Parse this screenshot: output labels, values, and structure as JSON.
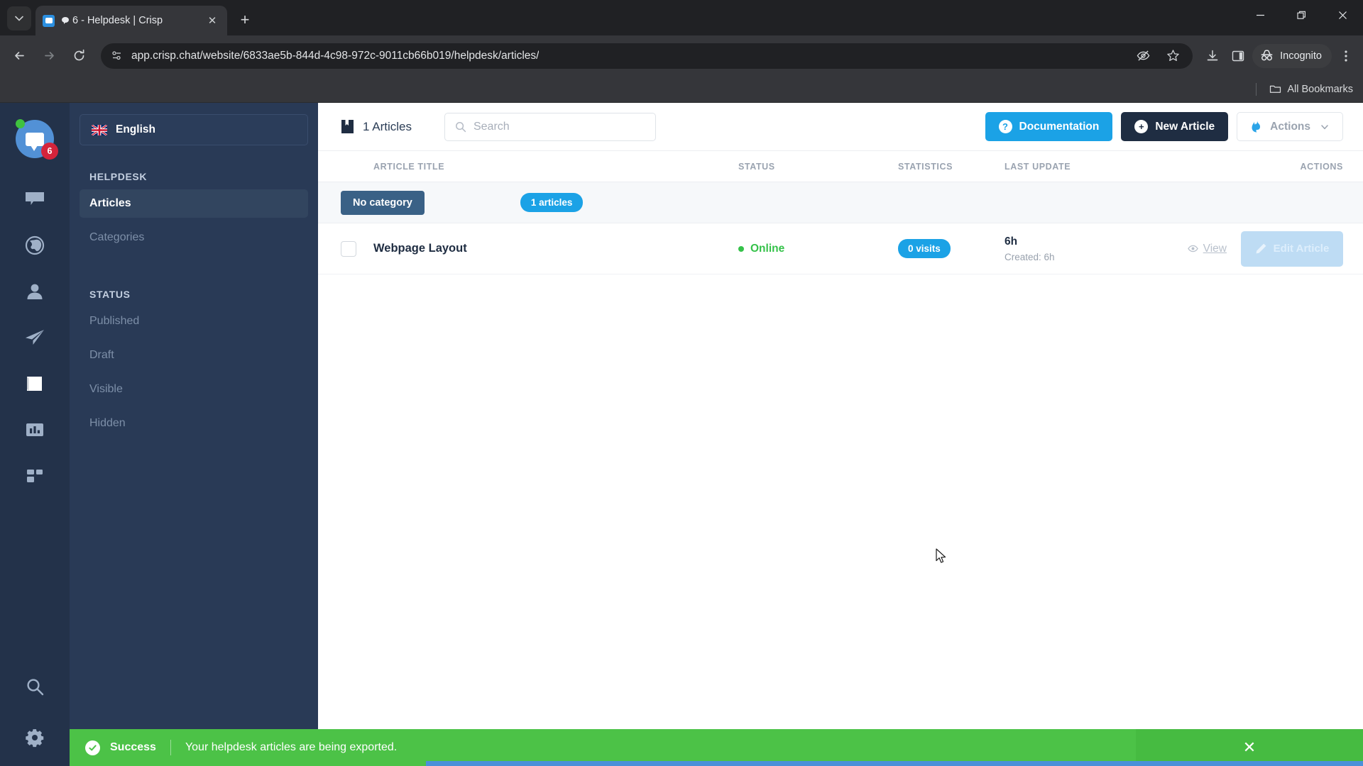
{
  "browser": {
    "tab": {
      "title": "6 - Helpdesk | Crisp",
      "favicon_name": "crisp-chat-favicon",
      "close_label": "✕"
    },
    "tab_search_label": "∨",
    "new_tab_label": "+",
    "window_controls": {
      "minimize": "—",
      "restore": "❐",
      "close": "✕"
    },
    "nav": {
      "back": "←",
      "forward": "→",
      "reload": "↻"
    },
    "url": "app.crisp.chat/website/6833ae5b-844d-4c98-972c-9011cb66b019/helpdesk/articles/",
    "incognito_label": "Incognito",
    "bookmarks_label": "All Bookmarks"
  },
  "rail": {
    "avatar": {
      "badge": "6",
      "status": "online"
    },
    "items": [
      {
        "name": "inbox-icon",
        "label": "Inbox"
      },
      {
        "name": "globe-icon",
        "label": "Visitors"
      },
      {
        "name": "contacts-icon",
        "label": "Contacts"
      },
      {
        "name": "campaigns-icon",
        "label": "Campaigns"
      },
      {
        "name": "helpdesk-icon",
        "label": "Helpdesk",
        "active": true
      },
      {
        "name": "analytics-icon",
        "label": "Analytics"
      },
      {
        "name": "plugins-icon",
        "label": "Plugins"
      }
    ],
    "bottom": [
      {
        "name": "search-icon",
        "label": "Search"
      },
      {
        "name": "gear-icon",
        "label": "Settings"
      }
    ]
  },
  "panel": {
    "language": "English",
    "language_flag": "uk-flag-icon",
    "sections": [
      {
        "heading": "HELPDESK",
        "items": [
          {
            "label": "Articles",
            "active": true
          },
          {
            "label": "Categories",
            "active": false
          }
        ]
      },
      {
        "heading": "STATUS",
        "items": [
          {
            "label": "Published",
            "active": false
          },
          {
            "label": "Draft",
            "active": false
          },
          {
            "label": "Visible",
            "active": false
          },
          {
            "label": "Hidden",
            "active": false
          }
        ]
      }
    ]
  },
  "topbar": {
    "count_label": "1 Articles",
    "count_icon": "book-icon",
    "search_placeholder": "Search",
    "search_value": "",
    "buttons": {
      "documentation": "Documentation",
      "new_article": "New Article",
      "actions": "Actions",
      "actions_caret": "∨",
      "documentation_icon": "?",
      "new_article_icon": "+"
    }
  },
  "table": {
    "columns": {
      "title": "ARTICLE TITLE",
      "status": "STATUS",
      "statistics": "STATISTICS",
      "last_update": "LAST UPDATE",
      "actions": "ACTIONS"
    },
    "category": {
      "name": "No category",
      "count": "1 articles"
    },
    "rows": [
      {
        "title": "Webpage Layout",
        "status": "Online",
        "visits": "0 visits",
        "updated": "6h",
        "created": "Created: 6h",
        "view_label": "View",
        "edit_label": "Edit Article"
      }
    ]
  },
  "toast": {
    "kind": "Success",
    "message": "Your helpdesk articles are being exported.",
    "close": "✕"
  },
  "colors": {
    "accent_blue": "#1ba2e6",
    "dark_navy": "#1f2d42",
    "rail_navy": "#23324a",
    "panel_navy": "#293a56",
    "success_green": "#4cc247",
    "status_green": "#35c24a"
  }
}
